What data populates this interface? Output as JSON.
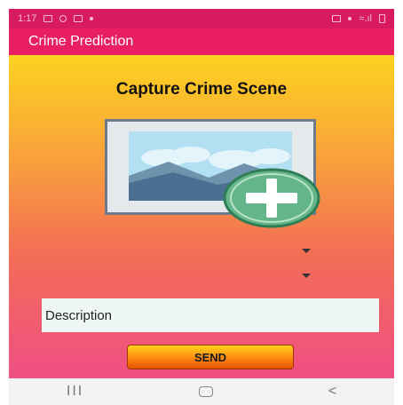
{
  "status_bar": {
    "time": "1:17"
  },
  "app_bar": {
    "title": "Crime Prediction"
  },
  "main": {
    "heading": "Capture Crime Scene",
    "image_placeholder_icon": "image-icon",
    "add_icon": "plus-icon",
    "description_placeholder": "Description",
    "send_label": "SEND"
  },
  "nav_bar": {
    "recent_glyph": "III",
    "back_glyph": "<"
  },
  "colors": {
    "status_bar": "#d81b60",
    "app_bar": "#e91e63",
    "gradient_top": "#fcd21f",
    "gradient_bottom": "#ef4f84",
    "send_button": "#ff8a13"
  }
}
